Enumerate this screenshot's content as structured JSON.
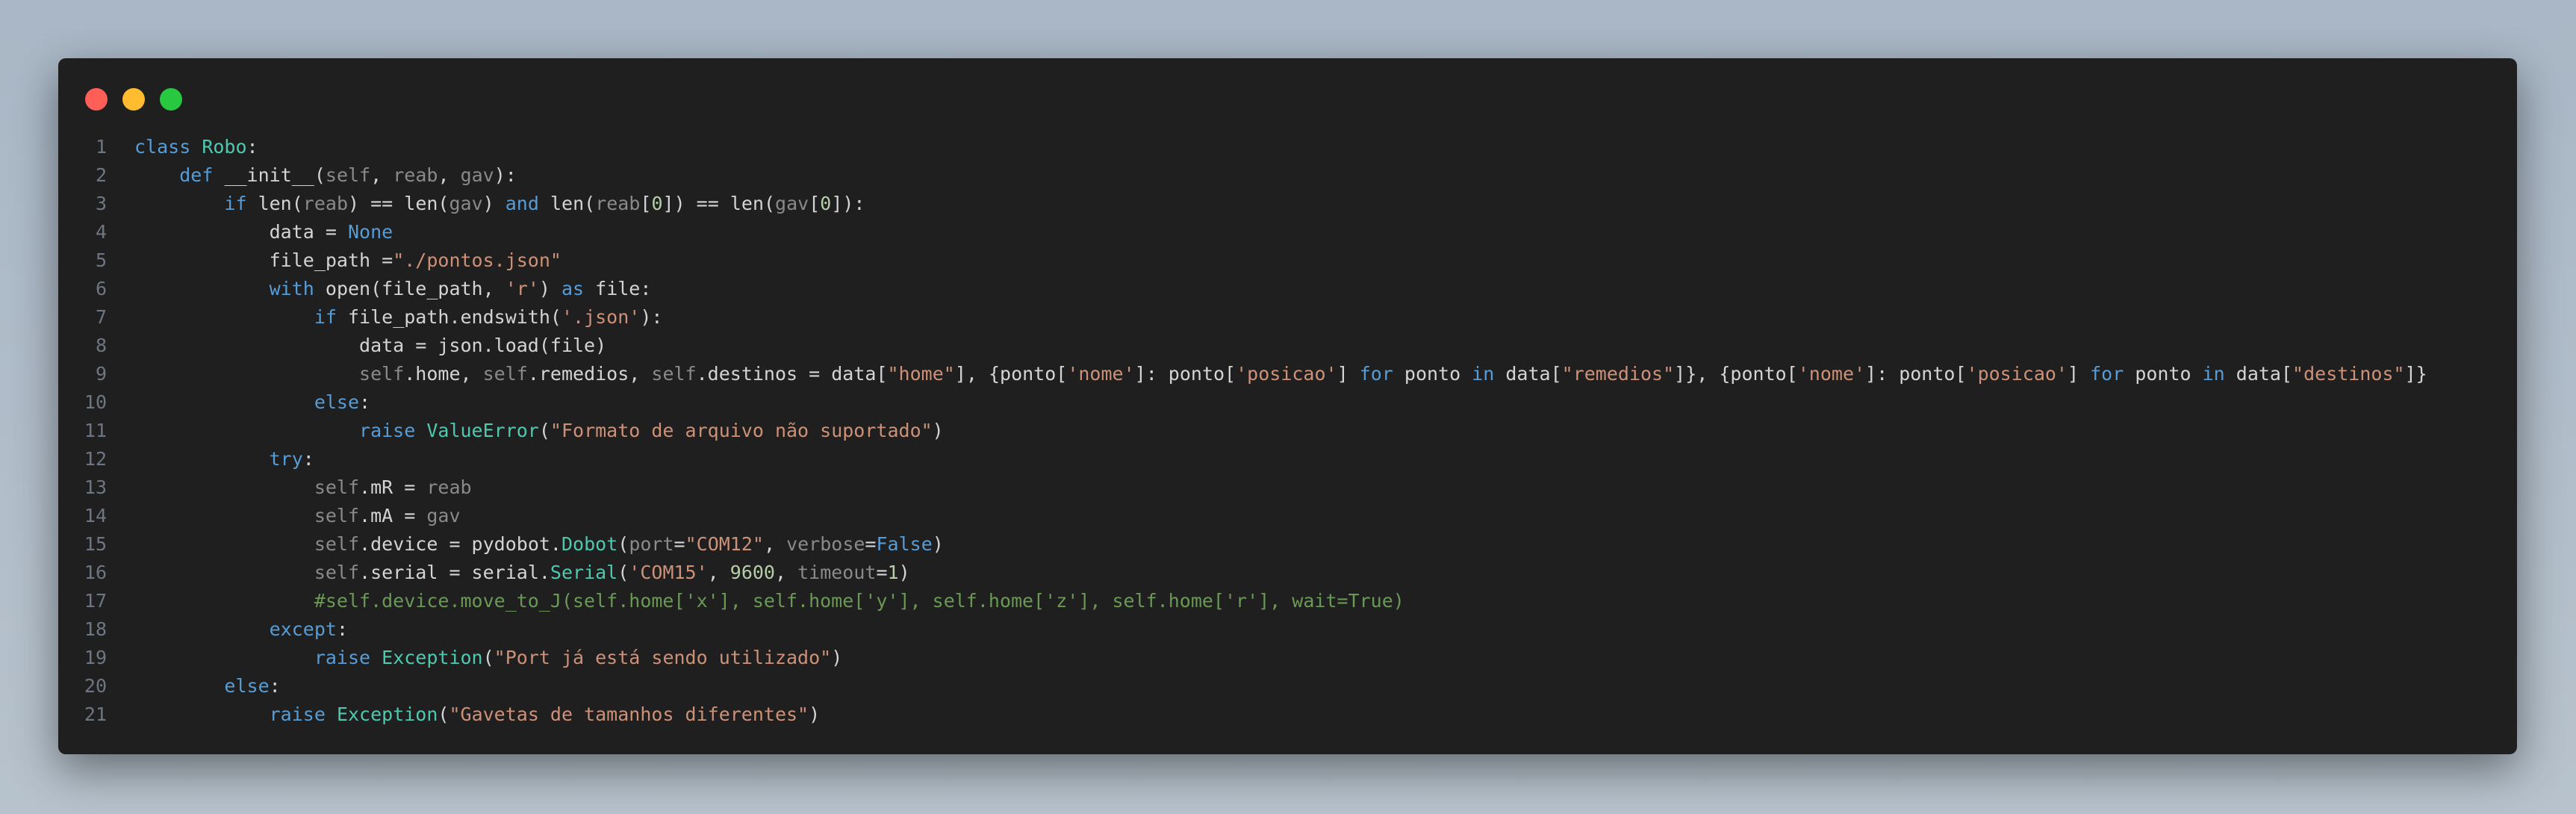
{
  "window": {
    "controls": [
      "close",
      "minimize",
      "maximize"
    ],
    "colors": {
      "close": "#ff5f57",
      "minimize": "#febc2e",
      "maximize": "#28c840",
      "background": "#1f1f1f"
    }
  },
  "code": {
    "lines": [
      {
        "n": "1",
        "tokens": [
          {
            "t": "class ",
            "c": "keyword"
          },
          {
            "t": "Robo",
            "c": "class"
          },
          {
            "t": ":",
            "c": "plain"
          }
        ]
      },
      {
        "n": "2",
        "tokens": [
          {
            "t": "    ",
            "c": "plain"
          },
          {
            "t": "def ",
            "c": "keyword"
          },
          {
            "t": "__init__(",
            "c": "plain"
          },
          {
            "t": "self",
            "c": "param"
          },
          {
            "t": ", ",
            "c": "plain"
          },
          {
            "t": "reab",
            "c": "param"
          },
          {
            "t": ", ",
            "c": "plain"
          },
          {
            "t": "gav",
            "c": "param"
          },
          {
            "t": "):",
            "c": "plain"
          }
        ]
      },
      {
        "n": "3",
        "tokens": [
          {
            "t": "        ",
            "c": "plain"
          },
          {
            "t": "if ",
            "c": "keyword"
          },
          {
            "t": "len(",
            "c": "plain"
          },
          {
            "t": "reab",
            "c": "param"
          },
          {
            "t": ") == len(",
            "c": "plain"
          },
          {
            "t": "gav",
            "c": "param"
          },
          {
            "t": ") ",
            "c": "plain"
          },
          {
            "t": "and ",
            "c": "keyword"
          },
          {
            "t": "len(",
            "c": "plain"
          },
          {
            "t": "reab",
            "c": "param"
          },
          {
            "t": "[",
            "c": "plain"
          },
          {
            "t": "0",
            "c": "number"
          },
          {
            "t": "]) == len(",
            "c": "plain"
          },
          {
            "t": "gav",
            "c": "param"
          },
          {
            "t": "[",
            "c": "plain"
          },
          {
            "t": "0",
            "c": "number"
          },
          {
            "t": "]):",
            "c": "plain"
          }
        ]
      },
      {
        "n": "4",
        "tokens": [
          {
            "t": "            data = ",
            "c": "plain"
          },
          {
            "t": "None",
            "c": "keyword"
          }
        ]
      },
      {
        "n": "5",
        "tokens": [
          {
            "t": "            file_path =",
            "c": "plain"
          },
          {
            "t": "\"./pontos.json\"",
            "c": "string"
          }
        ]
      },
      {
        "n": "6",
        "tokens": [
          {
            "t": "            ",
            "c": "plain"
          },
          {
            "t": "with ",
            "c": "keyword"
          },
          {
            "t": "open(file_path, ",
            "c": "plain"
          },
          {
            "t": "'r'",
            "c": "string"
          },
          {
            "t": ") ",
            "c": "plain"
          },
          {
            "t": "as ",
            "c": "keyword"
          },
          {
            "t": "file:",
            "c": "plain"
          }
        ]
      },
      {
        "n": "7",
        "tokens": [
          {
            "t": "                ",
            "c": "plain"
          },
          {
            "t": "if ",
            "c": "keyword"
          },
          {
            "t": "file_path.endswith(",
            "c": "plain"
          },
          {
            "t": "'.json'",
            "c": "string"
          },
          {
            "t": "):",
            "c": "plain"
          }
        ]
      },
      {
        "n": "8",
        "tokens": [
          {
            "t": "                    data = json.load(file)",
            "c": "plain"
          }
        ]
      },
      {
        "n": "9",
        "tokens": [
          {
            "t": "                    ",
            "c": "plain"
          },
          {
            "t": "self",
            "c": "param"
          },
          {
            "t": ".home, ",
            "c": "plain"
          },
          {
            "t": "self",
            "c": "param"
          },
          {
            "t": ".remedios, ",
            "c": "plain"
          },
          {
            "t": "self",
            "c": "param"
          },
          {
            "t": ".destinos = data[",
            "c": "plain"
          },
          {
            "t": "\"home\"",
            "c": "string"
          },
          {
            "t": "], {ponto[",
            "c": "plain"
          },
          {
            "t": "'nome'",
            "c": "string"
          },
          {
            "t": "]: ponto[",
            "c": "plain"
          },
          {
            "t": "'posicao'",
            "c": "string"
          },
          {
            "t": "] ",
            "c": "plain"
          },
          {
            "t": "for ",
            "c": "keyword"
          },
          {
            "t": "ponto ",
            "c": "plain"
          },
          {
            "t": "in ",
            "c": "keyword"
          },
          {
            "t": "data[",
            "c": "plain"
          },
          {
            "t": "\"remedios\"",
            "c": "string"
          },
          {
            "t": "]}, {ponto[",
            "c": "plain"
          },
          {
            "t": "'nome'",
            "c": "string"
          },
          {
            "t": "]: ponto[",
            "c": "plain"
          },
          {
            "t": "'posicao'",
            "c": "string"
          },
          {
            "t": "] ",
            "c": "plain"
          },
          {
            "t": "for ",
            "c": "keyword"
          },
          {
            "t": "ponto ",
            "c": "plain"
          },
          {
            "t": "in ",
            "c": "keyword"
          },
          {
            "t": "data[",
            "c": "plain"
          },
          {
            "t": "\"destinos\"",
            "c": "string"
          },
          {
            "t": "]}",
            "c": "plain"
          }
        ]
      },
      {
        "n": "10",
        "tokens": [
          {
            "t": "                ",
            "c": "plain"
          },
          {
            "t": "else",
            "c": "keyword"
          },
          {
            "t": ":",
            "c": "plain"
          }
        ]
      },
      {
        "n": "11",
        "tokens": [
          {
            "t": "                    ",
            "c": "plain"
          },
          {
            "t": "raise ",
            "c": "keyword"
          },
          {
            "t": "ValueError",
            "c": "class"
          },
          {
            "t": "(",
            "c": "plain"
          },
          {
            "t": "\"Formato de arquivo não suportado\"",
            "c": "string"
          },
          {
            "t": ")",
            "c": "plain"
          }
        ]
      },
      {
        "n": "12",
        "tokens": [
          {
            "t": "            ",
            "c": "plain"
          },
          {
            "t": "try",
            "c": "keyword"
          },
          {
            "t": ":",
            "c": "plain"
          }
        ]
      },
      {
        "n": "13",
        "tokens": [
          {
            "t": "                ",
            "c": "plain"
          },
          {
            "t": "self",
            "c": "param"
          },
          {
            "t": ".mR = ",
            "c": "plain"
          },
          {
            "t": "reab",
            "c": "param"
          }
        ]
      },
      {
        "n": "14",
        "tokens": [
          {
            "t": "                ",
            "c": "plain"
          },
          {
            "t": "self",
            "c": "param"
          },
          {
            "t": ".mA = ",
            "c": "plain"
          },
          {
            "t": "gav",
            "c": "param"
          }
        ]
      },
      {
        "n": "15",
        "tokens": [
          {
            "t": "                ",
            "c": "plain"
          },
          {
            "t": "self",
            "c": "param"
          },
          {
            "t": ".device = pydobot.",
            "c": "plain"
          },
          {
            "t": "Dobot",
            "c": "class"
          },
          {
            "t": "(",
            "c": "plain"
          },
          {
            "t": "port",
            "c": "param"
          },
          {
            "t": "=",
            "c": "plain"
          },
          {
            "t": "\"COM12\"",
            "c": "string"
          },
          {
            "t": ", ",
            "c": "plain"
          },
          {
            "t": "verbose",
            "c": "param"
          },
          {
            "t": "=",
            "c": "plain"
          },
          {
            "t": "False",
            "c": "keyword"
          },
          {
            "t": ")",
            "c": "plain"
          }
        ]
      },
      {
        "n": "16",
        "tokens": [
          {
            "t": "                ",
            "c": "plain"
          },
          {
            "t": "self",
            "c": "param"
          },
          {
            "t": ".serial = serial.",
            "c": "plain"
          },
          {
            "t": "Serial",
            "c": "class"
          },
          {
            "t": "(",
            "c": "plain"
          },
          {
            "t": "'COM15'",
            "c": "string"
          },
          {
            "t": ", ",
            "c": "plain"
          },
          {
            "t": "9600",
            "c": "number"
          },
          {
            "t": ", ",
            "c": "plain"
          },
          {
            "t": "timeout",
            "c": "param"
          },
          {
            "t": "=",
            "c": "plain"
          },
          {
            "t": "1",
            "c": "number"
          },
          {
            "t": ")",
            "c": "plain"
          }
        ]
      },
      {
        "n": "17",
        "tokens": [
          {
            "t": "                ",
            "c": "plain"
          },
          {
            "t": "#self.device.move_to_J(self.home['x'], self.home['y'], self.home['z'], self.home['r'], wait=True)",
            "c": "comment"
          }
        ]
      },
      {
        "n": "18",
        "tokens": [
          {
            "t": "            ",
            "c": "plain"
          },
          {
            "t": "except",
            "c": "keyword"
          },
          {
            "t": ":",
            "c": "plain"
          }
        ]
      },
      {
        "n": "19",
        "tokens": [
          {
            "t": "                ",
            "c": "plain"
          },
          {
            "t": "raise ",
            "c": "keyword"
          },
          {
            "t": "Exception",
            "c": "class"
          },
          {
            "t": "(",
            "c": "plain"
          },
          {
            "t": "\"Port já está sendo utilizado\"",
            "c": "string"
          },
          {
            "t": ")",
            "c": "plain"
          }
        ]
      },
      {
        "n": "20",
        "tokens": [
          {
            "t": "        ",
            "c": "plain"
          },
          {
            "t": "else",
            "c": "keyword"
          },
          {
            "t": ":",
            "c": "plain"
          }
        ]
      },
      {
        "n": "21",
        "tokens": [
          {
            "t": "            ",
            "c": "plain"
          },
          {
            "t": "raise ",
            "c": "keyword"
          },
          {
            "t": "Exception",
            "c": "class"
          },
          {
            "t": "(",
            "c": "plain"
          },
          {
            "t": "\"Gavetas de tamanhos diferentes\"",
            "c": "string"
          },
          {
            "t": ")",
            "c": "plain"
          }
        ]
      }
    ]
  }
}
